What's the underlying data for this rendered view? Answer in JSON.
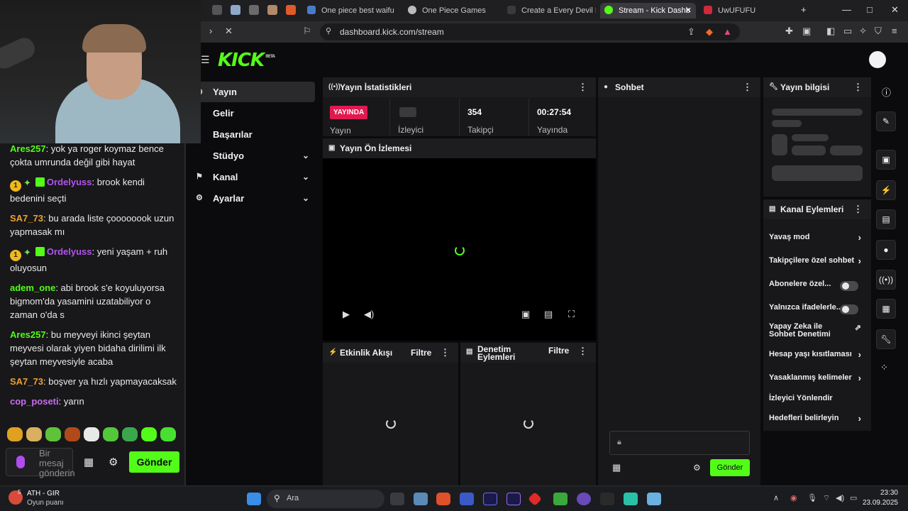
{
  "chat": {
    "messages": [
      {
        "user": "Ares257",
        "color": "#53fc18",
        "text": "yok ya roger koymaz bence çokta umrunda değil gibi hayat",
        "badges": false
      },
      {
        "user": "Ordelyuss",
        "color": "#b453f0",
        "text": "brook kendi bedenini seçti",
        "badges": true,
        "badge_num": "1"
      },
      {
        "user": "SA7_73",
        "color": "#f0a030",
        "text": "bu arada liste çoooooook uzun yapmasak mı",
        "badges": false
      },
      {
        "user": "Ordelyuss",
        "color": "#b453f0",
        "text": "yeni yaşam + ruh oluyosun",
        "badges": true,
        "badge_num": "1"
      },
      {
        "user": "adem_one",
        "color": "#53fc18",
        "text": "abi brook s'e koyuluyorsa bigmom'da yasamini uzatabiliyor o zaman o'da s",
        "badges": false
      },
      {
        "user": "Ares257",
        "color": "#53fc18",
        "text": "bu meyveyi ikinci şeytan meyvesi olarak yiyen bidaha dirilimi ilk şeytan meyvesiyle acaba",
        "badges": false
      },
      {
        "user": "SA7_73",
        "color": "#f0a030",
        "text": "boşver ya hızlı yapmayacaksak",
        "badges": false
      },
      {
        "user": "cop_poseti",
        "color": "#c86cf0",
        "text": "yarın",
        "badges": false
      }
    ],
    "input_placeholder": "Bir mesaj gönderin",
    "send_label": "Gönder"
  },
  "browser": {
    "tabs": [
      {
        "label": "One piece best waifu - Q",
        "active": false
      },
      {
        "label": "One Piece Games",
        "active": false
      },
      {
        "label": "Create a Every Devil Fruit",
        "active": false
      },
      {
        "label": "Stream - Kick Dashb",
        "active": true
      },
      {
        "label": "UwUFUFU",
        "active": false
      }
    ],
    "url": "dashboard.kick.com/stream"
  },
  "kick": {
    "logo": "KICK",
    "logo_sup": "BETA",
    "nav": [
      {
        "label": "Yayın",
        "active": true,
        "chevron": false
      },
      {
        "label": "Gelir",
        "active": false,
        "chevron": false
      },
      {
        "label": "Başarılar",
        "active": false,
        "chevron": false
      },
      {
        "label": "Stüdyo",
        "active": false,
        "chevron": true
      },
      {
        "label": "Kanal",
        "active": false,
        "chevron": true
      },
      {
        "label": "Ayarlar",
        "active": false,
        "chevron": true
      }
    ],
    "stats": {
      "title": "Yayın İstatistikleri",
      "live_badge": "YAYINDA",
      "items": [
        {
          "value": "",
          "label": "Yayın"
        },
        {
          "value": "",
          "label": "İzleyici"
        },
        {
          "value": "354",
          "label": "Takipçi"
        },
        {
          "value": "00:27:54",
          "label": "Yayında"
        }
      ]
    },
    "preview_title": "Yayın Ön İzlemesi",
    "activity_title": "Etkinlik Akışı",
    "activity_filter": "Filtre",
    "mod_title_1": "Denetim",
    "mod_title_2": "Eylemleri",
    "mod_filter": "Filtre",
    "chat_title": "Sohbet",
    "chat_send": "Gönder",
    "info_title": "Yayın bilgisi",
    "actions_title": "Kanal Eylemleri",
    "actions": [
      {
        "label": "Yavaş mod",
        "type": "arrow"
      },
      {
        "label": "Takipçilere özel sohbet",
        "type": "arrow"
      },
      {
        "label": "Abonelere özel...",
        "type": "toggle"
      },
      {
        "label": "Yalnızca ifadelerle...",
        "type": "toggle"
      },
      {
        "label": "Yapay Zeka ile Sohbet Denetimi",
        "type": "external"
      },
      {
        "label": "Hesap yaşı kısıtlaması",
        "type": "arrow"
      },
      {
        "label": "Yasaklanmış kelimeler",
        "type": "arrow"
      },
      {
        "label": "İzleyici Yönlendir",
        "type": "none"
      },
      {
        "label": "Hedefleri belirleyin",
        "type": "arrow"
      }
    ]
  },
  "taskbar": {
    "weather_temp": "5",
    "game_name": "ATH - GIR",
    "game_sub": "Oyun puanı",
    "search": "Ara",
    "time": "23:30",
    "date": "23.09.2025"
  },
  "colors": {
    "accent": "#53fc18",
    "live": "#e01a4f",
    "bg": "#0b0b0d",
    "panel": "#18181a"
  }
}
